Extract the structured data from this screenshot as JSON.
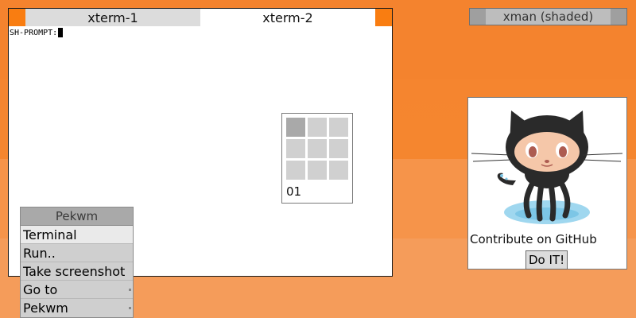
{
  "terminal": {
    "tabs": [
      {
        "label": "xterm-1",
        "active": false
      },
      {
        "label": "xterm-2",
        "active": true
      }
    ],
    "prompt": "SH-PROMPT:"
  },
  "pager": {
    "rows": 3,
    "cols": 3,
    "current_index": 0,
    "workspace_label": "01"
  },
  "menu": {
    "title": "Pekwm",
    "items": [
      {
        "label": "Terminal",
        "submenu": false
      },
      {
        "label": "Run..",
        "submenu": false
      },
      {
        "label": "Take screenshot",
        "submenu": false
      },
      {
        "label": "Go to",
        "submenu": true
      },
      {
        "label": "Pekwm",
        "submenu": true
      }
    ]
  },
  "shaded_window": {
    "title": "xman (shaded)"
  },
  "github": {
    "text": "Contribute on GitHub",
    "button_label": "Do IT!",
    "icon": "octocat-icon"
  },
  "colors": {
    "accent": "#f97d11",
    "desktop_bg": "#f4832e"
  }
}
